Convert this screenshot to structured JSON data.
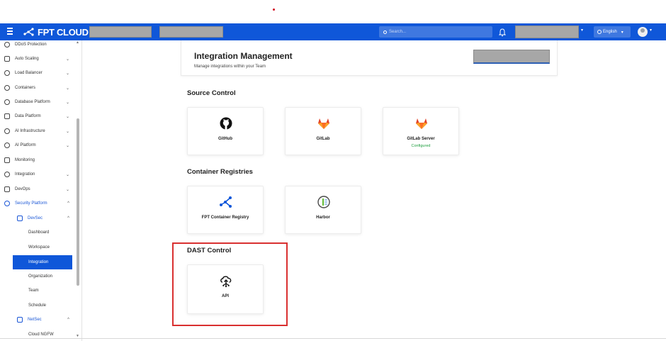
{
  "navbar": {
    "brand": "FPT CLOUD",
    "search_placeholder": "Search...",
    "language": "English",
    "menu_icon": "hamburger-icon",
    "notification_icon": "bell-icon",
    "avatar_icon": "user-avatar-icon",
    "accent_color": "#0f57d9"
  },
  "sidebar": {
    "items": [
      {
        "label": "DDoS Protection",
        "icon": "shield-icon"
      },
      {
        "label": "Auto Scaling",
        "icon": "scaling-icon",
        "chevron": "⌄"
      },
      {
        "label": "Load Balancer",
        "icon": "balancer-icon",
        "chevron": "⌄"
      },
      {
        "label": "Containers",
        "icon": "container-icon",
        "chevron": "⌄"
      },
      {
        "label": "Database Platform",
        "icon": "database-icon",
        "chevron": "⌄"
      },
      {
        "label": "Data Platform",
        "icon": "data-platform-icon",
        "chevron": "⌄"
      },
      {
        "label": "AI Infrastructure",
        "icon": "ai-infrastructure-icon",
        "chevron": "⌄"
      },
      {
        "label": "AI Platform",
        "icon": "ai-platform-icon",
        "chevron": "⌄"
      },
      {
        "label": "Monitoring",
        "icon": "monitoring-icon"
      },
      {
        "label": "Integration",
        "icon": "integration-icon",
        "chevron": "⌄"
      },
      {
        "label": "DevOps",
        "icon": "devops-icon",
        "chevron": "⌄"
      },
      {
        "label": "Security Platform",
        "icon": "security-platform-icon",
        "chevron": "^"
      }
    ],
    "devsec": {
      "label": "DevSec",
      "icon": "devsec-icon",
      "chevron": "^"
    },
    "devsec_children": [
      "Dashboard",
      "Workspace",
      "Integration",
      "Organization",
      "Team",
      "Schedule"
    ],
    "active_child": "Integration",
    "netsec": {
      "label": "NetSec",
      "icon": "netsec-icon",
      "chevron": "^"
    },
    "netsec_children": [
      "Cloud NGFW"
    ]
  },
  "header": {
    "title": "Integration Management",
    "subtitle": "Manage integrations within your Team"
  },
  "source_control": {
    "title": "Source Control",
    "cards": [
      {
        "label": "GitHub",
        "icon": "github-icon",
        "status": ""
      },
      {
        "label": "GitLab",
        "icon": "gitlab-icon",
        "status": ""
      },
      {
        "label": "GitLab Server",
        "icon": "gitlab-server-icon",
        "status": "Configured"
      }
    ]
  },
  "container_registries": {
    "title": "Container Registries",
    "cards": [
      {
        "label": "FPT Container Registry",
        "icon": "fpt-registry-icon"
      },
      {
        "label": "Harbor",
        "icon": "harbor-icon"
      }
    ]
  },
  "dast_control": {
    "title": "DAST Control",
    "cards": [
      {
        "label": "API",
        "icon": "api-icon"
      }
    ],
    "highlight_color": "#d93030"
  },
  "status_color": "#1e9e3e"
}
